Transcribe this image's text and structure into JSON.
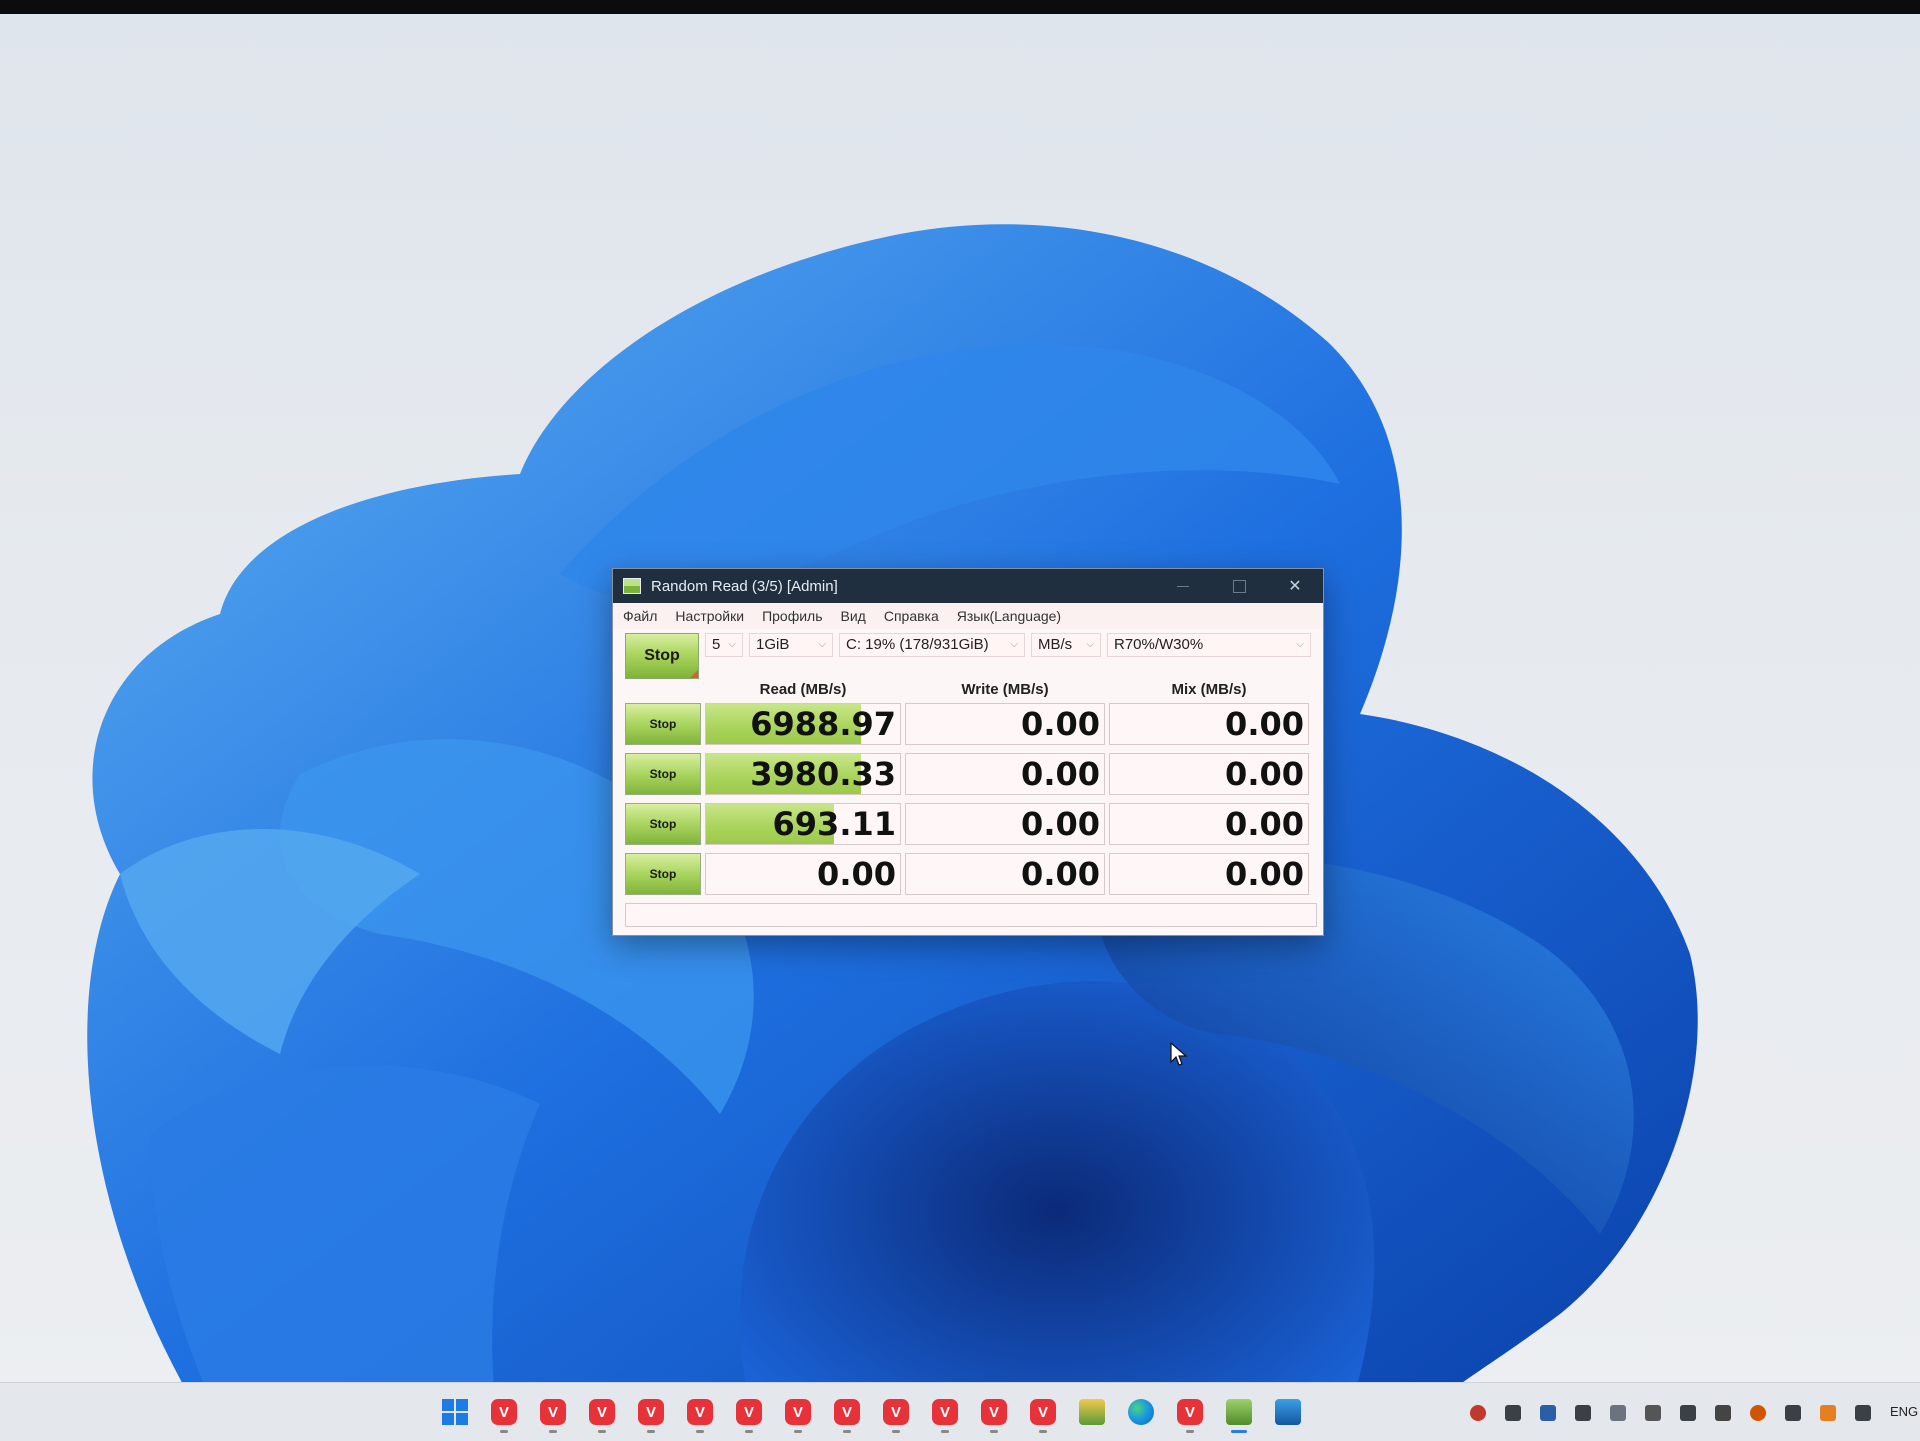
{
  "window": {
    "title": "Random Read (3/5) [Admin]",
    "menu": [
      "Файл",
      "Настройки",
      "Профиль",
      "Вид",
      "Справка",
      "Язык(Language)"
    ]
  },
  "toolbar": {
    "all_stop_label": "Stop",
    "count": "5",
    "size": "1GiB",
    "drive": "C: 19% (178/931GiB)",
    "unit": "MB/s",
    "mix": "R70%/W30%"
  },
  "columns": {
    "read": "Read (MB/s)",
    "write": "Write (MB/s)",
    "mix": "Mix (MB/s)"
  },
  "rows": [
    {
      "button": "Stop",
      "read": "6988.97",
      "write": "0.00",
      "mix": "0.00",
      "read_fill": 0.8
    },
    {
      "button": "Stop",
      "read": "3980.33",
      "write": "0.00",
      "mix": "0.00",
      "read_fill": 0.8
    },
    {
      "button": "Stop",
      "read": "693.11",
      "write": "0.00",
      "mix": "0.00",
      "read_fill": 0.66
    },
    {
      "button": "Stop",
      "read": "0.00",
      "write": "0.00",
      "mix": "0.00",
      "read_fill": 0
    }
  ],
  "taskbar": {
    "apps": [
      "start-icon",
      "vivaldi-icon",
      "vivaldi-icon",
      "vivaldi-icon",
      "vivaldi-icon",
      "vivaldi-icon",
      "vivaldi-icon",
      "vivaldi-icon",
      "vivaldi-icon",
      "vivaldi-icon",
      "vivaldi-icon",
      "vivaldi-icon",
      "vivaldi-icon",
      "app-icon",
      "edge-icon",
      "vivaldi-icon",
      "crystaldiskmark-icon",
      "app-icon"
    ],
    "language": "ENG"
  },
  "colors": {
    "titlebar": "#1f2f3f",
    "bar_green": "#a9d35a",
    "wallpaper_blue": "#1d6fe0"
  }
}
